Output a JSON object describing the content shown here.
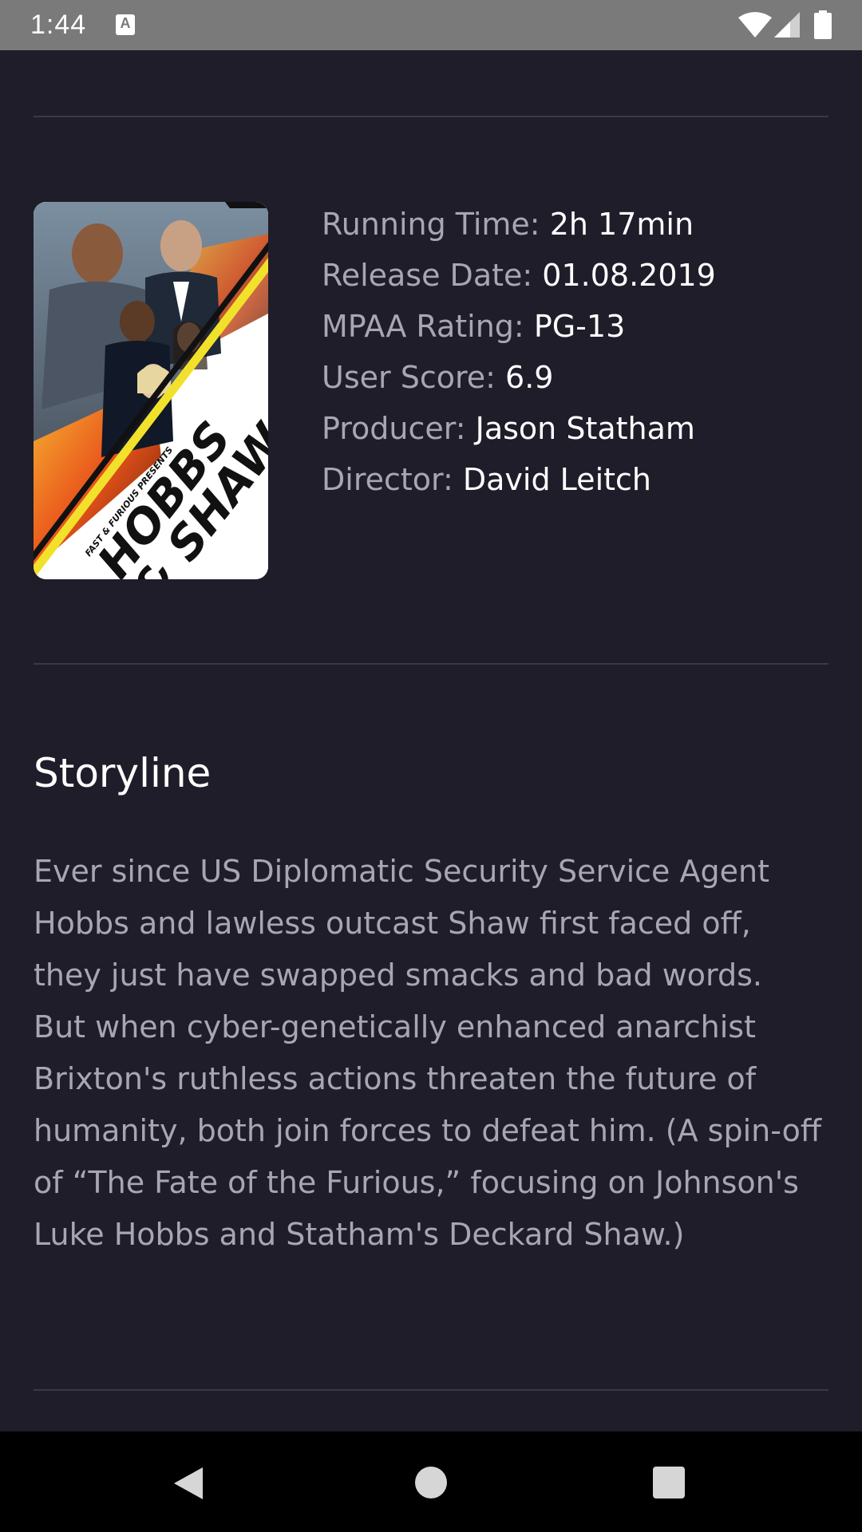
{
  "status_bar": {
    "time": "1:44",
    "notification_icon_letter": "A",
    "icons": [
      "a-notification-icon",
      "wifi-icon",
      "signal-icon",
      "battery-icon"
    ]
  },
  "movie": {
    "poster_icon": "movie-poster-image",
    "poster_text_top": "FAST & FURIOUS PRESENTS",
    "poster_text_title_line1": "HOBBS",
    "poster_text_title_line2": "& SHAW",
    "details": [
      {
        "label": "Running Time:",
        "value": "2h 17min"
      },
      {
        "label": "Release Date:",
        "value": "01.08.2019"
      },
      {
        "label": "MPAA Rating:",
        "value": "PG-13"
      },
      {
        "label": "User Score:",
        "value": "6.9"
      },
      {
        "label": "Producer:",
        "value": "Jason Statham"
      },
      {
        "label": "Director:",
        "value": "David Leitch"
      }
    ]
  },
  "storyline": {
    "heading": "Storyline",
    "text": "Ever since US Diplomatic Security Service Agent Hobbs and lawless outcast Shaw first faced off, they just have swapped smacks and bad words. But when cyber-genetically enhanced anarchist Brixton's ruthless actions threaten the future of humanity, both join forces to defeat him. (A spin-off of “The Fate of the Furious,” focusing on Johnson's Luke Hobbs and Statham's Deckard Shaw.)"
  },
  "nav_bar": {
    "icons": [
      "back-icon",
      "home-icon",
      "recent-apps-icon"
    ]
  },
  "colors": {
    "background": "#1e1d29",
    "label": "#a7a6b3",
    "value": "#ffffff",
    "divider": "#3a3946",
    "status_bar": "#7a7a7a",
    "nav_bar": "#000000"
  }
}
